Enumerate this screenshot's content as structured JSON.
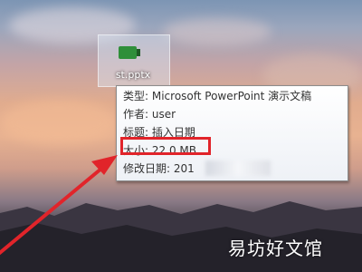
{
  "desktop": {
    "file": {
      "name": "st.pptx",
      "icon": "pptx-file-icon"
    }
  },
  "tooltip": {
    "type_line": "类型: Microsoft PowerPoint 演示文稿",
    "author_line": "作者: user",
    "title_line": "标题: 插入日期",
    "size_line": "大小: 22.0 MB",
    "modified_line": "修改日期: 201"
  },
  "annotation": {
    "highlight_color": "#e1242a"
  },
  "watermark": "易坊好文馆"
}
